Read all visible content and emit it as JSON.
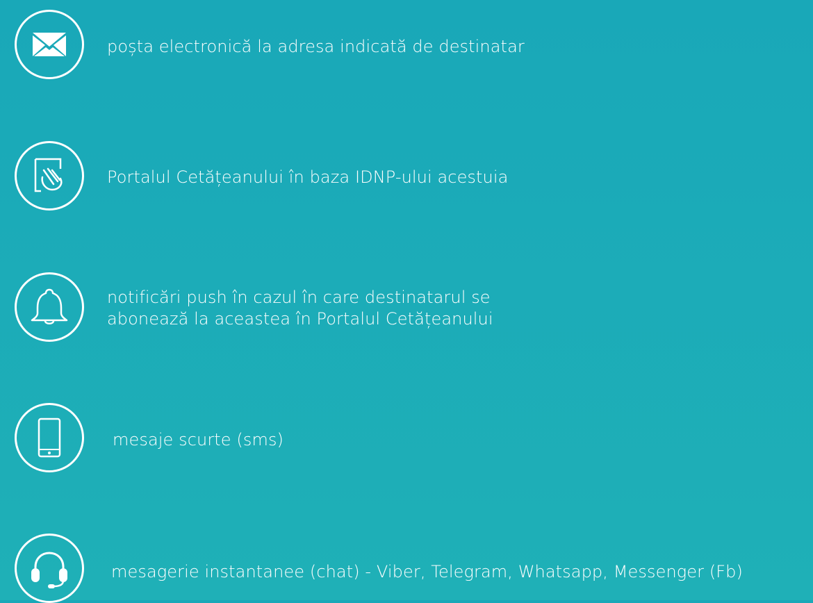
{
  "channels": [
    {
      "icon": "envelope-icon",
      "lines": [
        "poșta electronică la adresa indicată de destinatar"
      ]
    },
    {
      "icon": "tablet-touch-icon",
      "lines": [
        "Portalul Cetățeanului în baza IDNP-ului acestuia"
      ]
    },
    {
      "icon": "bell-icon",
      "lines": [
        "notificări push în cazul în care destinatarul se",
        "abonează la aceastea în Portalul Cetățeanului"
      ]
    },
    {
      "icon": "mobile-phone-icon",
      "lines": [
        "mesaje scurte (sms)"
      ]
    },
    {
      "icon": "headset-icon",
      "lines": [
        "mesagerie instantanee (chat) - Viber, Telegram, Whatsapp, Messenger (Fb)"
      ]
    }
  ],
  "colors": {
    "background": "#1bacb8",
    "foreground": "#ffffff"
  }
}
